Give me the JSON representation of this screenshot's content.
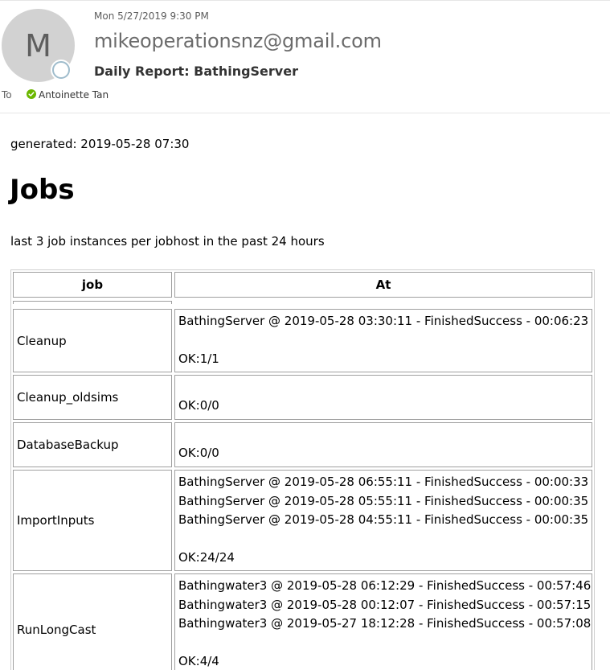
{
  "email": {
    "date": "Mon 5/27/2019 9:30 PM",
    "sender": "mikeoperationsnz@gmail.com",
    "avatar_initial": "M",
    "subject": "Daily Report: BathingServer",
    "to_label": "To",
    "recipient": "Antoinette Tan",
    "colors": {
      "avatar_bg": "#d2d2d2",
      "presence_ring": "#9fbccc",
      "verified_green": "#6bb700"
    }
  },
  "report": {
    "generated": "generated: 2019-05-28 07:30",
    "heading": "Jobs",
    "description": "last 3 job instances per jobhost in the past 24 hours",
    "table": {
      "headers": [
        "job",
        "At"
      ],
      "rows": [
        {
          "job": "Cleanup",
          "instances": [
            "BathingServer @ 2019-05-28 03:30:11 - FinishedSuccess - 00:06:23"
          ],
          "ok": "OK:1/1"
        },
        {
          "job": "Cleanup_oldsims",
          "instances": [],
          "ok": "OK:0/0"
        },
        {
          "job": "DatabaseBackup",
          "instances": [],
          "ok": "OK:0/0"
        },
        {
          "job": "ImportInputs",
          "instances": [
            "BathingServer @ 2019-05-28 06:55:11 - FinishedSuccess - 00:00:33",
            "BathingServer @ 2019-05-28 05:55:11 - FinishedSuccess - 00:00:35",
            "BathingServer @ 2019-05-28 04:55:11 - FinishedSuccess - 00:00:35"
          ],
          "ok": "OK:24/24"
        },
        {
          "job": "RunLongCast",
          "instances": [
            "Bathingwater3 @ 2019-05-28 06:12:29 - FinishedSuccess - 00:57:46",
            "Bathingwater3 @ 2019-05-28 00:12:07 - FinishedSuccess - 00:57:15",
            "Bathingwater3 @ 2019-05-27 18:12:28 - FinishedSuccess - 00:57:08"
          ],
          "ok": "OK:4/4"
        }
      ]
    }
  }
}
